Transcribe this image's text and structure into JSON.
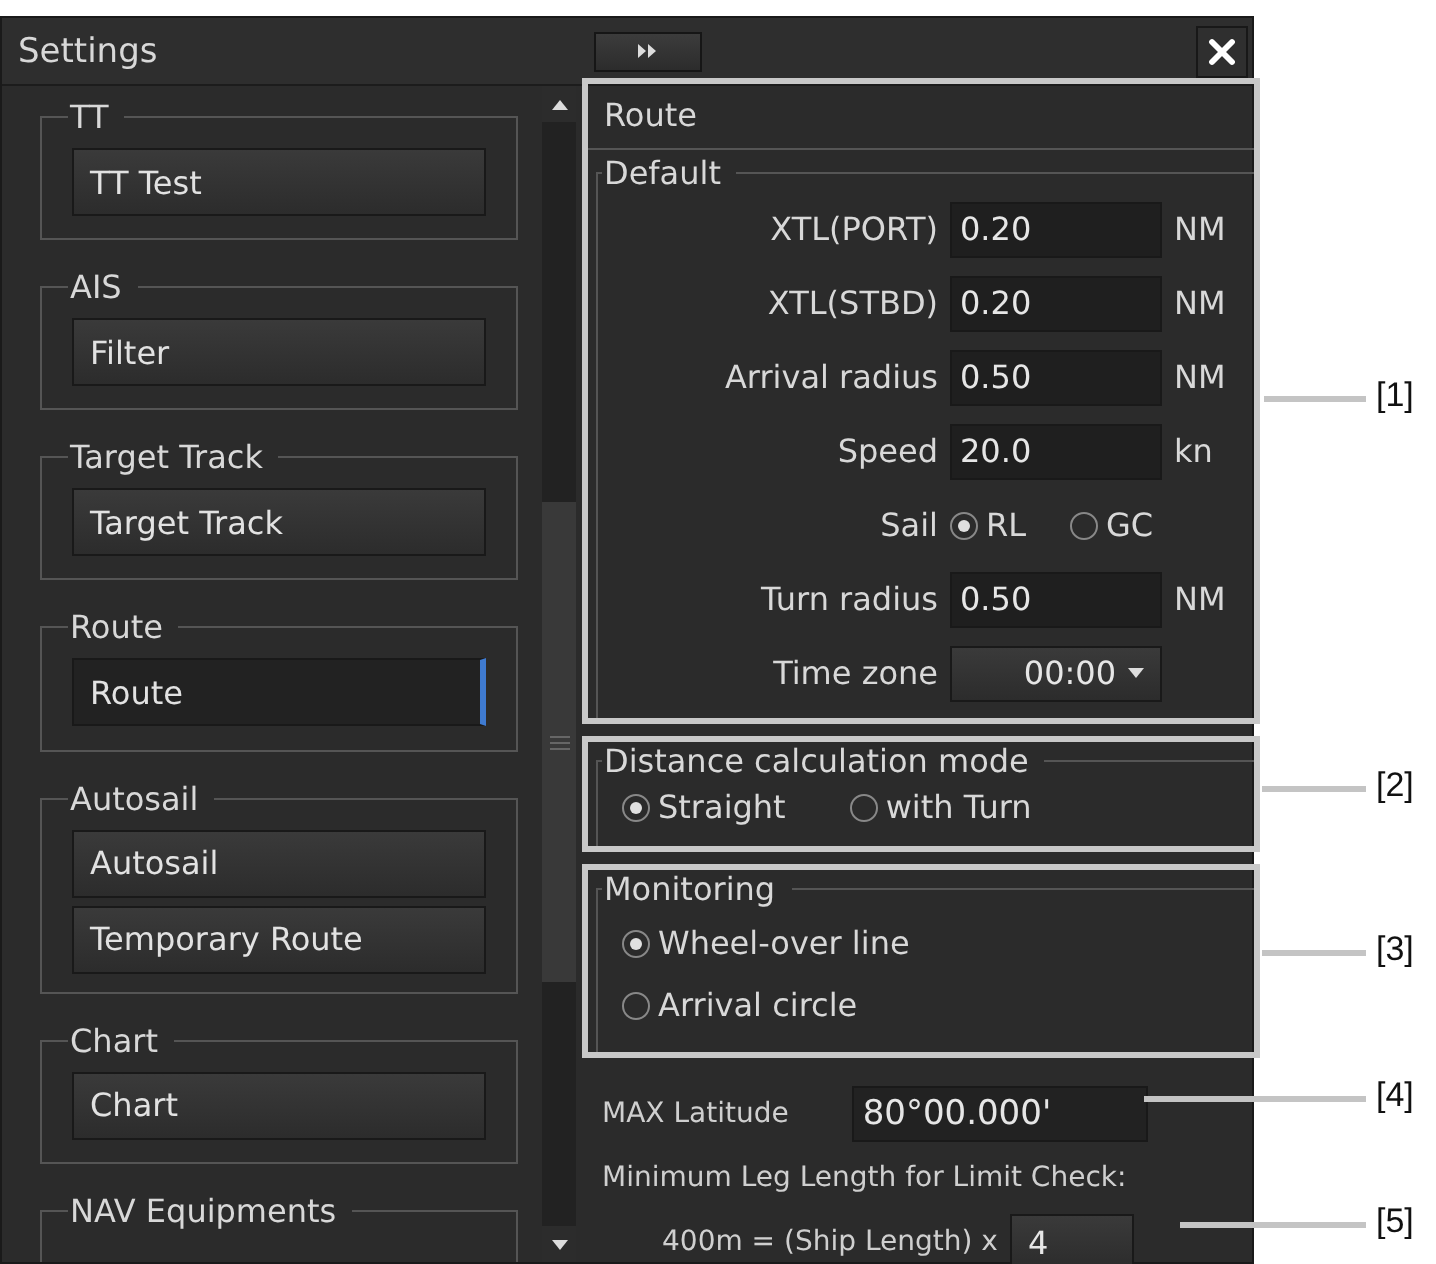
{
  "window": {
    "title": "Settings"
  },
  "sidebar": {
    "groups": [
      {
        "legend": "TT",
        "items": [
          {
            "label": "TT Test",
            "selected": false
          }
        ]
      },
      {
        "legend": "AIS",
        "items": [
          {
            "label": "Filter",
            "selected": false
          }
        ]
      },
      {
        "legend": "Target Track",
        "items": [
          {
            "label": "Target Track",
            "selected": false
          }
        ]
      },
      {
        "legend": "Route",
        "items": [
          {
            "label": "Route",
            "selected": true
          }
        ]
      },
      {
        "legend": "Autosail",
        "items": [
          {
            "label": "Autosail",
            "selected": false
          },
          {
            "label": "Temporary Route",
            "selected": false
          }
        ]
      },
      {
        "legend": "Chart",
        "items": [
          {
            "label": "Chart",
            "selected": false
          }
        ]
      },
      {
        "legend": "NAV Equipments"
      }
    ]
  },
  "route": {
    "title": "Route",
    "default": {
      "legend": "Default",
      "rows": [
        {
          "kind": "field",
          "label": "XTL(PORT)",
          "value": "0.20",
          "unit": "NM"
        },
        {
          "kind": "field",
          "label": "XTL(STBD)",
          "value": "0.20",
          "unit": "NM"
        },
        {
          "kind": "field",
          "label": "Arrival radius",
          "value": "0.50",
          "unit": "NM"
        },
        {
          "kind": "field",
          "label": "Speed",
          "value": "20.0",
          "unit": "kn"
        },
        {
          "kind": "radio",
          "label": "Sail",
          "options": [
            {
              "label": "RL",
              "selected": true
            },
            {
              "label": "GC",
              "selected": false
            }
          ]
        },
        {
          "kind": "field",
          "label": "Turn radius",
          "value": "0.50",
          "unit": "NM"
        },
        {
          "kind": "dropdown",
          "label": "Time zone",
          "value": "00:00"
        }
      ]
    },
    "distance_mode": {
      "legend": "Distance calculation mode",
      "options": [
        {
          "label": "Straight",
          "selected": true
        },
        {
          "label": "with Turn",
          "selected": false
        }
      ]
    },
    "monitoring": {
      "legend": "Monitoring",
      "options": [
        {
          "label": "Wheel-over line",
          "selected": true
        },
        {
          "label": "Arrival circle",
          "selected": false
        }
      ]
    },
    "max_latitude": {
      "label": "MAX Latitude",
      "value": "80°00.000'"
    },
    "min_leg": {
      "label": "Minimum Leg Length for Limit Check:",
      "formula": "400m = (Ship Length) x",
      "value": "4"
    }
  },
  "callouts": [
    "[1]",
    "[2]",
    "[3]",
    "[4]",
    "[5]"
  ]
}
